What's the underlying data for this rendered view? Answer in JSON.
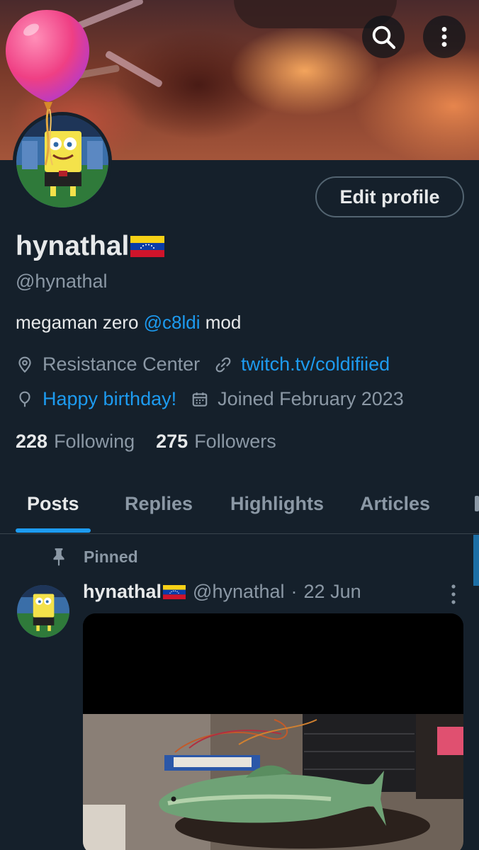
{
  "header": {
    "search_icon": "search-icon",
    "more_icon": "more-vertical-icon"
  },
  "profile": {
    "name": "hynathal",
    "flag": "venezuela-flag",
    "handle": "@hynathal",
    "edit_label": "Edit profile",
    "bio_prefix": "megaman zero ",
    "bio_mention": "@c8ldi",
    "bio_suffix": " mod",
    "location": "Resistance Center",
    "website": "twitch.tv/coldifiied",
    "birthday": "Happy birthday!",
    "joined": "Joined February 2023",
    "following_count": "228",
    "following_label": "Following",
    "followers_count": "275",
    "followers_label": "Followers"
  },
  "tabs": [
    {
      "label": "Posts",
      "active": true
    },
    {
      "label": "Replies",
      "active": false
    },
    {
      "label": "Highlights",
      "active": false
    },
    {
      "label": "Articles",
      "active": false
    }
  ],
  "post": {
    "pinned_label": "Pinned",
    "author_name": "hynathal",
    "author_handle": "@hynathal",
    "separator": "·",
    "date": "22 Jun"
  },
  "colors": {
    "background": "#15202b",
    "accent": "#1d9bf0",
    "secondary_text": "#8b98a5"
  }
}
